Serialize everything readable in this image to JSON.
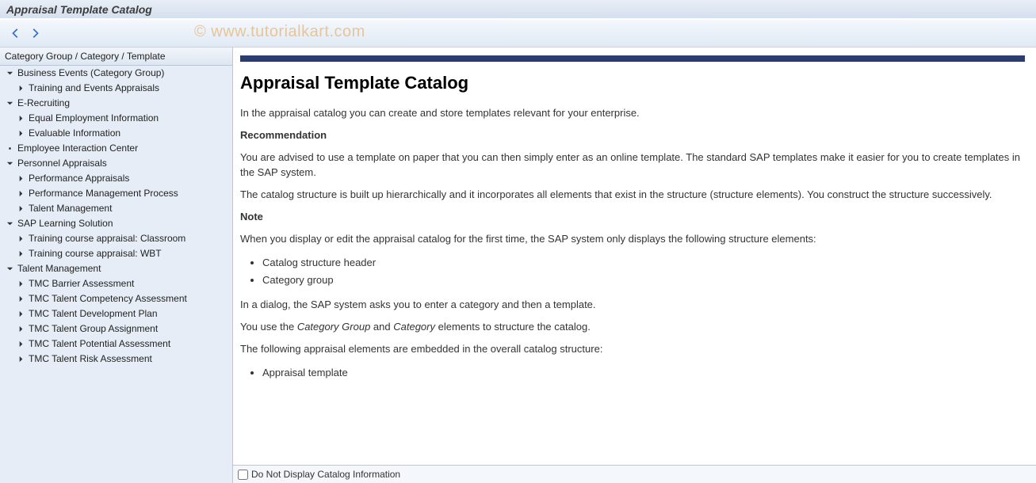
{
  "window": {
    "title": "Appraisal Template Catalog"
  },
  "toolbar": {
    "watermark": "© www.tutorialkart.com"
  },
  "tree": {
    "header": "Category Group / Category / Template",
    "nodes": [
      {
        "label": "Business Events (Category Group)",
        "level": 0,
        "expanded": true,
        "leaf": false
      },
      {
        "label": "Training and Events Appraisals",
        "level": 1,
        "expanded": false,
        "leaf": false
      },
      {
        "label": "E-Recruiting",
        "level": 0,
        "expanded": true,
        "leaf": false
      },
      {
        "label": "Equal Employment Information",
        "level": 1,
        "expanded": false,
        "leaf": false
      },
      {
        "label": "Evaluable Information",
        "level": 1,
        "expanded": false,
        "leaf": false
      },
      {
        "label": "Employee Interaction Center",
        "level": 0,
        "expanded": false,
        "leaf": true
      },
      {
        "label": "Personnel Appraisals",
        "level": 0,
        "expanded": true,
        "leaf": false
      },
      {
        "label": "Performance Appraisals",
        "level": 1,
        "expanded": false,
        "leaf": false
      },
      {
        "label": "Performance Management Process",
        "level": 1,
        "expanded": false,
        "leaf": false
      },
      {
        "label": "Talent Management",
        "level": 1,
        "expanded": false,
        "leaf": false
      },
      {
        "label": "SAP Learning Solution",
        "level": 0,
        "expanded": true,
        "leaf": false
      },
      {
        "label": "Training course appraisal: Classroom",
        "level": 1,
        "expanded": false,
        "leaf": false
      },
      {
        "label": "Training course appraisal: WBT",
        "level": 1,
        "expanded": false,
        "leaf": false
      },
      {
        "label": "Talent Management",
        "level": 0,
        "expanded": true,
        "leaf": false
      },
      {
        "label": "TMC Barrier Assessment",
        "level": 1,
        "expanded": false,
        "leaf": false
      },
      {
        "label": "TMC Talent Competency Assessment",
        "level": 1,
        "expanded": false,
        "leaf": false
      },
      {
        "label": "TMC Talent Development Plan",
        "level": 1,
        "expanded": false,
        "leaf": false
      },
      {
        "label": "TMC Talent Group Assignment",
        "level": 1,
        "expanded": false,
        "leaf": false
      },
      {
        "label": "TMC Talent Potential Assessment",
        "level": 1,
        "expanded": false,
        "leaf": false
      },
      {
        "label": "TMC Talent Risk Assessment",
        "level": 1,
        "expanded": false,
        "leaf": false
      }
    ]
  },
  "content": {
    "heading": "Appraisal Template Catalog",
    "p1": "In the appraisal catalog you can create and store templates relevant for your enterprise.",
    "h_recommendation": "Recommendation",
    "p2": "You are advised to use a template on paper that you can then simply enter as an online template. The standard SAP templates make it easier for you to create templates in the SAP system.",
    "p3": "The catalog structure is built up hierarchically and it incorporates all elements that exist in the structure (structure elements). You construct the structure successively.",
    "h_note": "Note",
    "p4": "When you display or edit the appraisal catalog for the first time, the SAP system only displays the following structure elements:",
    "list1": [
      "Catalog structure header",
      "Category group"
    ],
    "p5": "In a dialog, the SAP system asks you to enter a category and then a template.",
    "p6_a": "You use the ",
    "p6_b": "Category Group",
    "p6_c": " and ",
    "p6_d": "Category",
    "p6_e": " elements to structure the catalog.",
    "p7": "The following appraisal elements are embedded in the overall catalog structure:",
    "list2": [
      "Appraisal template"
    ]
  },
  "footer": {
    "checkbox_label": "Do Not Display Catalog Information"
  }
}
